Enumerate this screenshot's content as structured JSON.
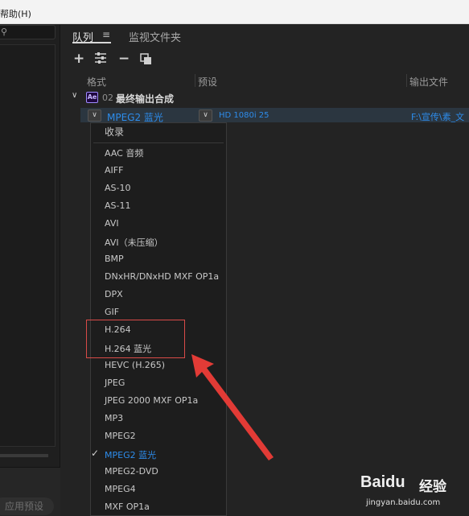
{
  "menubar": {
    "help_label": "帮助(H)"
  },
  "left_panel": {
    "apply_preset_label": "应用预设"
  },
  "queue_panel": {
    "tabs": [
      {
        "label": "队列",
        "active": true
      },
      {
        "label": "监视文件夹",
        "active": false
      }
    ],
    "columns": {
      "format": "格式",
      "preset": "预设",
      "output": "输出文件"
    },
    "group": {
      "badge": "Ae",
      "number": "02",
      "title": "最终输出合成"
    },
    "item": {
      "format": "MPEG2 蓝光",
      "preset": "HD 1080i 25",
      "output": "F:\\宣传\\素_文"
    }
  },
  "dropdown": {
    "header": "收录",
    "items": [
      "AAC 音频",
      "AIFF",
      "AS-10",
      "AS-11",
      "AVI",
      "AVI（未压缩）",
      "BMP",
      "DNxHR/DNxHD MXF OP1a",
      "DPX",
      "GIF",
      "H.264",
      "H.264 蓝光",
      "HEVC (H.265)",
      "JPEG",
      "JPEG 2000 MXF OP1a",
      "MP3",
      "MPEG2",
      "MPEG2 蓝光",
      "MPEG2-DVD",
      "MPEG4",
      "MXF OP1a"
    ],
    "selected": "MPEG2 蓝光"
  },
  "annotation": {
    "highlight_color": "#d94b48"
  },
  "watermark": {
    "logo": "Baidu",
    "cn": "经验",
    "url": "jingyan.baidu.com"
  },
  "colors": {
    "accent": "#2d8ceb",
    "background": "#232323"
  }
}
